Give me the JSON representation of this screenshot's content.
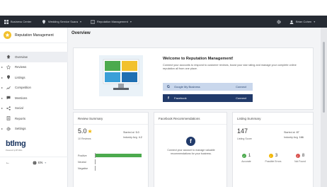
{
  "topbar": {
    "business_center": "Business Center",
    "location": "Wedding Service Suara",
    "product": "Reputation Management",
    "user": "Brian Cohen"
  },
  "sidebar": {
    "title": "Reputation Management",
    "items": [
      {
        "label": "Overview",
        "icon": "home-icon",
        "active": true,
        "arrow": false
      },
      {
        "label": "Reviews",
        "icon": "star-icon",
        "arrow": true
      },
      {
        "label": "Listings",
        "icon": "pin-icon",
        "arrow": true
      },
      {
        "label": "Competition",
        "icon": "graph-icon",
        "arrow": true
      },
      {
        "label": "Mentions",
        "icon": "chat-icon",
        "arrow": true
      },
      {
        "label": "Social",
        "icon": "social-icon",
        "arrow": true
      },
      {
        "label": "Reports",
        "icon": "report-icon",
        "arrow": true
      },
      {
        "label": "Settings",
        "icon": "gear-icon",
        "arrow": true
      }
    ],
    "brand": "btlmg",
    "powered_by": "Powered by BTLMG",
    "language": "EN"
  },
  "main": {
    "title": "Overview",
    "welcome": {
      "title": "Welcome to Reputation Management!",
      "description": "Connect your accounts to respond to customer reviews, boost your star rating and manage your complete online reputation all from one place.",
      "google_label": "Google My Business",
      "google_action": "Connect",
      "facebook_label": "Facebook",
      "facebook_action": "Connect"
    },
    "review_summary": {
      "title": "Review Summary",
      "score": "5.0",
      "count": "10 Reviews",
      "started_label": "Started at",
      "started_value": "5.0",
      "industry_label": "Industry Avg",
      "industry_value": "4.2",
      "sentiments": [
        {
          "label": "Positive",
          "fraction": 1.0
        },
        {
          "label": "Neutral",
          "fraction": 0.0
        },
        {
          "label": "Negative",
          "fraction": 0.0
        }
      ]
    },
    "facebook_recs": {
      "title": "Facebook Recommendations",
      "text": "Connect your account to manage valuable recommendations for your business."
    },
    "listing_summary": {
      "title": "Listing Summary",
      "score": "147",
      "score_label": "Listing Score",
      "started_label": "Started at",
      "started_value": "87",
      "industry_label": "Industry Avg",
      "industry_value": "166",
      "metrics": [
        {
          "value": "1",
          "label": "Accurate",
          "color": "#4caa4e"
        },
        {
          "value": "3",
          "label": "Possible Errors",
          "color": "#f2b705"
        },
        {
          "value": "8",
          "label": "Not Found",
          "color": "#d9534f"
        }
      ]
    }
  },
  "colors": {
    "topbar": "#262b33",
    "accent_green": "#4caa4e",
    "facebook_blue": "#213a6a",
    "google_bg": "#c9d7ec",
    "star": "#f2b705"
  }
}
